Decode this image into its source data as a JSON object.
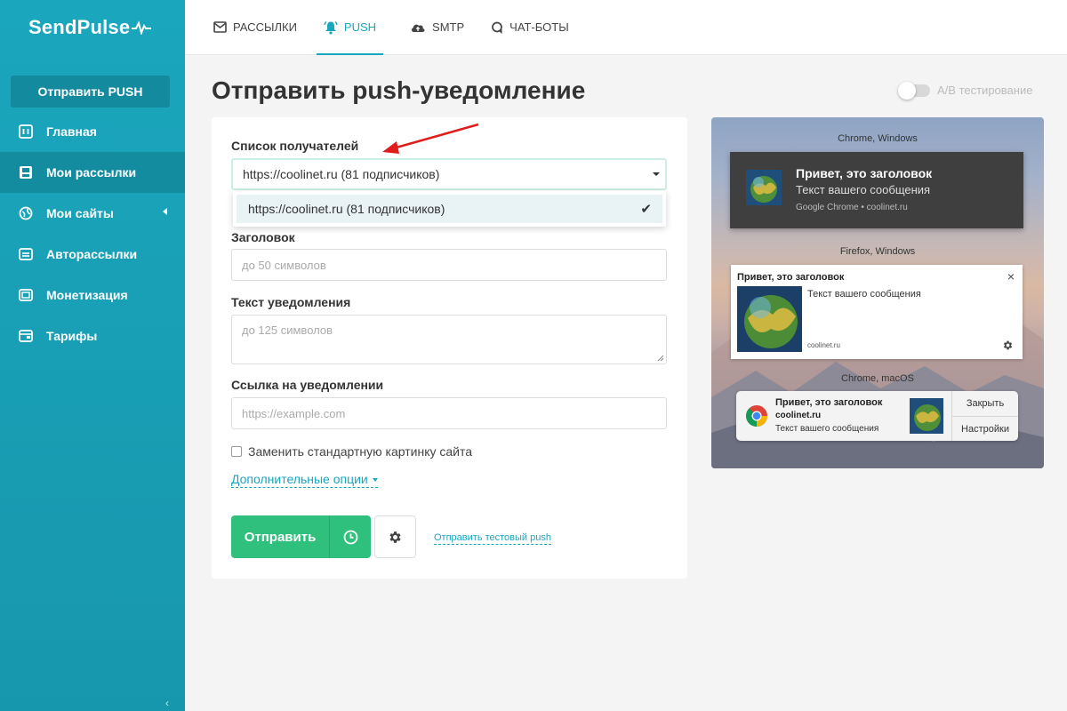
{
  "app": {
    "logo": "SendPulse"
  },
  "colors": {
    "brand": "#1aa6bd",
    "send_green": "#2fc07e",
    "sidebar_active": "#138ca0"
  },
  "topnav": {
    "tabs": [
      {
        "label": "РАССЫЛКИ",
        "icon": "envelope-icon"
      },
      {
        "label": "PUSH",
        "icon": "bell-icon",
        "active": true
      },
      {
        "label": "SMTP",
        "icon": "cloud-icon"
      },
      {
        "label": "ЧАТ-БОТЫ",
        "icon": "chat-icon"
      }
    ]
  },
  "sidebar": {
    "send_push_label": "Отправить PUSH",
    "items": [
      {
        "label": "Главная",
        "icon": "dashboard-icon"
      },
      {
        "label": "Мои рассылки",
        "icon": "save-icon",
        "active": true
      },
      {
        "label": "Мои сайты",
        "icon": "globe-icon"
      },
      {
        "label": "Авторассылки",
        "icon": "auto-icon"
      },
      {
        "label": "Монетизация",
        "icon": "money-icon"
      },
      {
        "label": "Тарифы",
        "icon": "wallet-icon"
      }
    ]
  },
  "page": {
    "title": "Отправить push-уведомление",
    "ab_test_label": "A/B тестирование"
  },
  "form": {
    "recipients_label": "Список получателей",
    "recipients_value": "https://coolinet.ru (81 подписчиков)",
    "dropdown_option": "https://coolinet.ru (81 подписчиков)",
    "title_label": "Заголовок",
    "title_placeholder": "до 50 символов",
    "text_label": "Текст уведомления",
    "text_placeholder": "до 125 символов",
    "link_label": "Ссылка на уведомлении",
    "link_placeholder": "https://example.com",
    "replace_image_label": "Заменить стандартную картинку сайта",
    "more_options": "Дополнительные опции",
    "send_label": "Отправить",
    "test_push_link": "Отправить тестовый push"
  },
  "preview": {
    "chrome_windows": {
      "caption": "Chrome, Windows",
      "title": "Привет, это заголовок",
      "message": "Текст вашего сообщения",
      "source": "Google Chrome • coolinet.ru"
    },
    "firefox_windows": {
      "caption": "Firefox, Windows",
      "title": "Привет, это заголовок",
      "message": "Текст вашего сообщения",
      "source": "coolinet.ru",
      "close": "×"
    },
    "chrome_macos": {
      "caption": "Chrome, macOS",
      "title": "Привет, это заголовок",
      "domain": "coolinet.ru",
      "message": "Текст вашего сообщения",
      "close_button": "Закрыть",
      "settings_button": "Настройки"
    }
  }
}
